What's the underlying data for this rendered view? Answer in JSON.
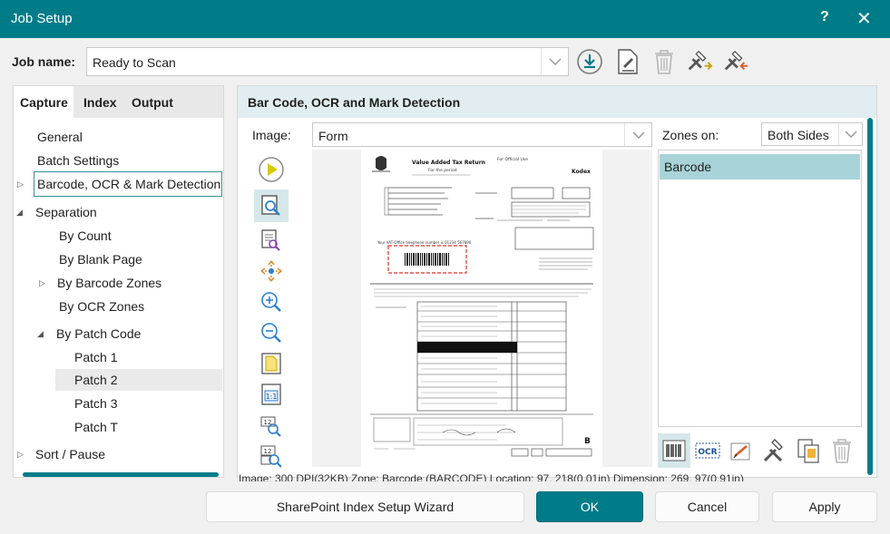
{
  "window": {
    "title": "Job Setup",
    "help_label": "?",
    "close_label": "✕"
  },
  "job": {
    "label": "Job name:",
    "value": "Ready to Scan",
    "toolbar_icons": [
      "download-icon",
      "edit-document-icon",
      "trash-icon",
      "tools-export-icon",
      "tools-import-icon"
    ]
  },
  "left": {
    "tabs": [
      {
        "label": "Capture",
        "active": true
      },
      {
        "label": "Index",
        "active": false
      },
      {
        "label": "Output",
        "active": false
      }
    ],
    "tree": [
      {
        "label": "General"
      },
      {
        "label": "Batch Settings"
      },
      {
        "label": "Barcode, OCR & Mark Detection",
        "selected": true
      },
      {
        "label": "Separation",
        "expanded": true
      },
      {
        "label": "By Count"
      },
      {
        "label": "By Blank Page"
      },
      {
        "label": "By Barcode Zones"
      },
      {
        "label": "By OCR Zones"
      },
      {
        "label": "By Patch Code",
        "expanded": true
      },
      {
        "label": "Patch 1"
      },
      {
        "label": "Patch 2",
        "highlighted": true
      },
      {
        "label": "Patch 3"
      },
      {
        "label": "Patch T"
      },
      {
        "label": "Sort / Pause"
      }
    ]
  },
  "right": {
    "section_title": "Bar Code, OCR and Mark Detection",
    "image_label": "Image:",
    "image_value": "Form",
    "zones_label": "Zones on:",
    "zones_value": "Both Sides",
    "zone_list": [
      "Barcode"
    ],
    "status_text": "Image: 300 DPI(32KB)   Zone: Barcode (BARCODE) Location: 97, 218(0.01in)   Dimension: 269, 97(0.91in)",
    "doc": {
      "title": "Value Added Tax Return",
      "subtitle": "For the period",
      "official": "For Official Use",
      "brand": "Kodex",
      "barcode_note": "Your VAT Office telephone number is 01234 567890",
      "corner": "B"
    }
  },
  "buttons": {
    "wizard": "SharePoint Index Setup Wizard",
    "ok": "OK",
    "cancel": "Cancel",
    "apply": "Apply"
  },
  "colors": {
    "accent": "#007c89",
    "selection": "#a8d3d8",
    "active_tool": "#d6e7ea",
    "barcode_zone": "#e0312b"
  }
}
